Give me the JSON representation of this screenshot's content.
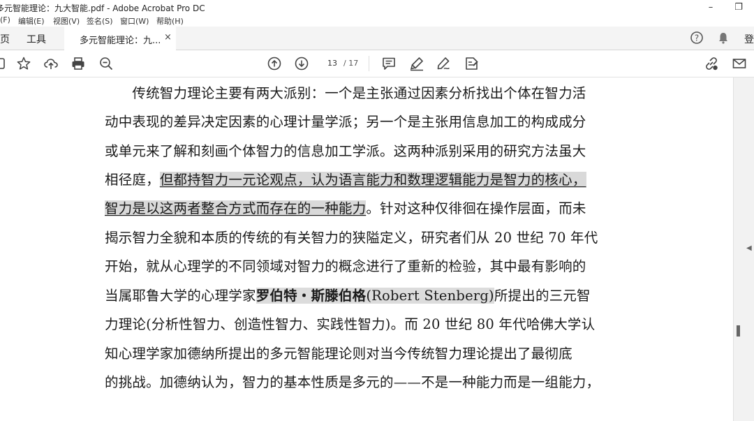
{
  "window": {
    "title": "多元智能理论：九大智能.pdf - Adobe Acrobat Pro DC",
    "minimize": "–",
    "restore": "❐"
  },
  "menu": [
    "(F)",
    "编辑(E)",
    "视图(V)",
    "签名(S)",
    "窗口(W)",
    "帮助(H)"
  ],
  "tabs": {
    "home": "页",
    "tools": "工具",
    "document": "多元智能理论：九...",
    "close": "×",
    "login_fragment": "登"
  },
  "toolbar": {
    "page_current": "13",
    "page_total": "/ 17"
  },
  "document": {
    "lines": [
      {
        "parts": [
          {
            "t": "　　传统智力理论主要有两大派别：一个是主张通过因素分析找出个体在智力活",
            "s": ""
          }
        ]
      },
      {
        "parts": [
          {
            "t": "动中表现的差异决定因素的心理计量学派；另一个是主张用信息加工的构成成分",
            "s": ""
          }
        ]
      },
      {
        "parts": [
          {
            "t": "或单元来了解和刻画个体智力的信息加工学派。这两种派别采用的研究方法虽大",
            "s": ""
          }
        ]
      },
      {
        "parts": [
          {
            "t": "相径庭，",
            "s": ""
          },
          {
            "t": "但都持智力一元论观点，认为语言能力和数理逻辑能力是智力的核心，",
            "s": "hl"
          }
        ]
      },
      {
        "parts": [
          {
            "t": "智力是以这两者整合方式而存在的一种能力",
            "s": "hl"
          },
          {
            "t": "。针对这种仅徘徊在操作层面，而未",
            "s": ""
          }
        ]
      },
      {
        "parts": [
          {
            "t": "揭示智力全貌和本质的传统的有关智力的狭隘定义，研究者们从 20 世纪 70 年代",
            "s": ""
          }
        ]
      },
      {
        "parts": [
          {
            "t": "开始，就从心理学的不同领域对智力的概念进行了重新的检验，其中最有影响的",
            "s": ""
          }
        ]
      },
      {
        "parts": [
          {
            "t": "当属耶鲁大学的心理学家",
            "s": ""
          },
          {
            "t": "罗伯特・斯滕伯格",
            "s": "hlb"
          },
          {
            "t": "(Robert Stenberg)",
            "s": "hlg"
          },
          {
            "t": "所提出的三元智",
            "s": ""
          }
        ]
      },
      {
        "parts": [
          {
            "t": "力理论(分析性智力、创造性智力、实践性智力)。而 20 世纪 80 年代哈佛大学认",
            "s": ""
          }
        ]
      },
      {
        "parts": [
          {
            "t": "知心理学家加德纳所提出的多元智能理论则对当今传统智力理论提出了最彻底",
            "s": ""
          }
        ]
      },
      {
        "parts": [
          {
            "t": "的挑战。加德纳认为，智力的基本性质是多元的——不是一种能力而是一组能力，",
            "s": ""
          }
        ]
      }
    ]
  }
}
